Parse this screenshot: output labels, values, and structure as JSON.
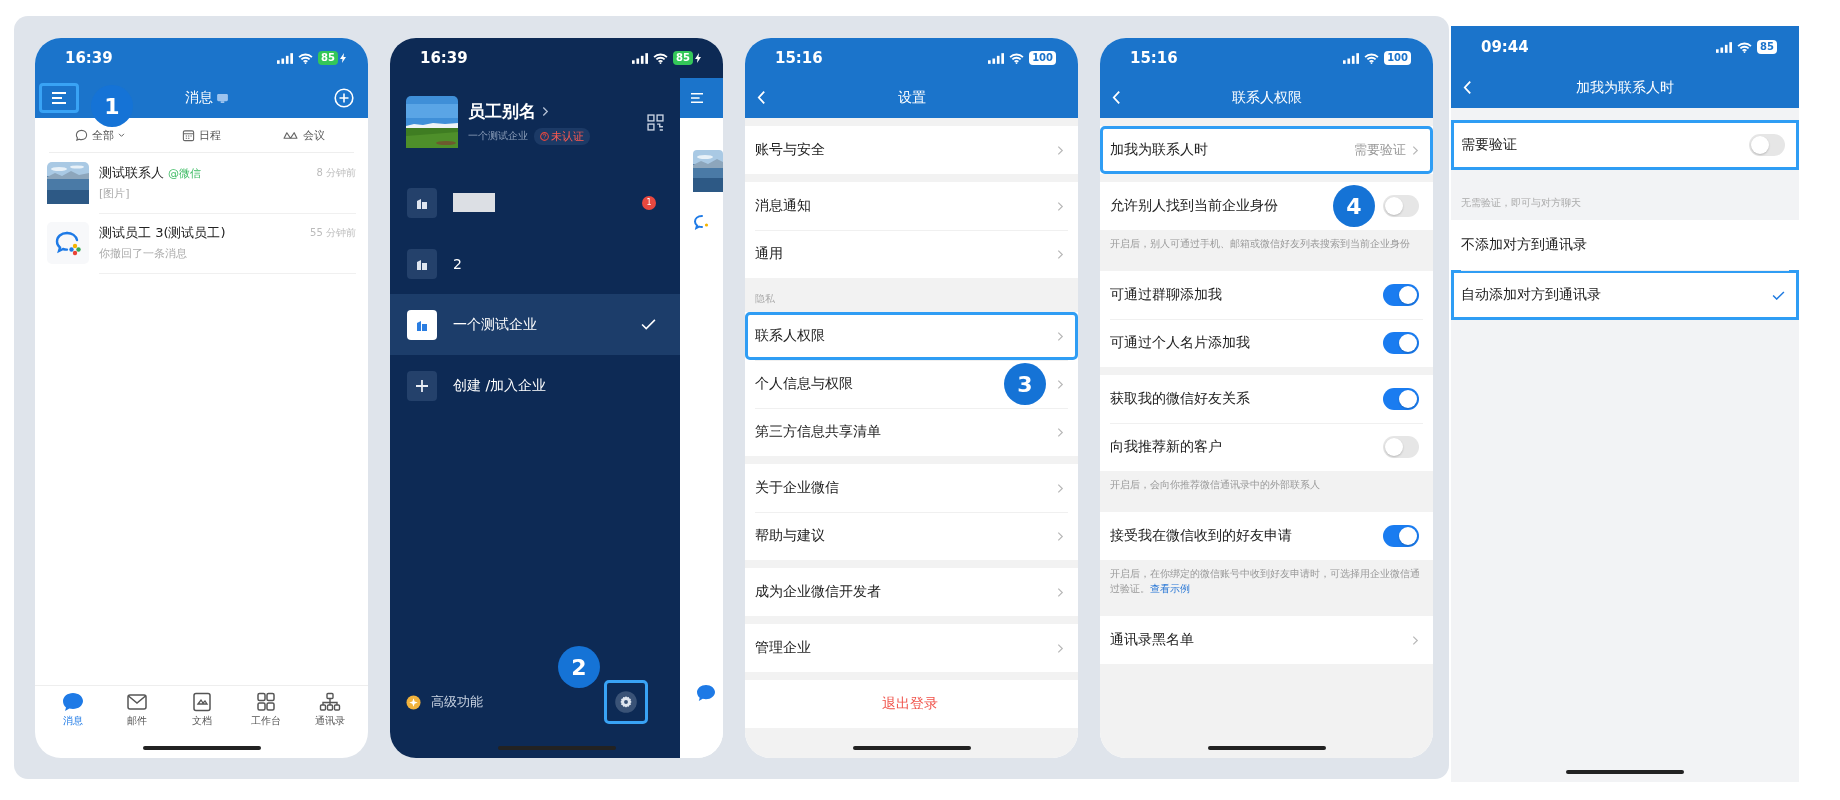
{
  "panel_screens": [
    {
      "kind": "messages",
      "status": {
        "time": "16:39",
        "battery": "85",
        "charging": true
      },
      "header": {
        "title": "消息",
        "menu_highlighted": true,
        "step": "1"
      },
      "filters": [
        {
          "label": "全部",
          "kind": "all"
        },
        {
          "label": "日程",
          "kind": "calendar"
        },
        {
          "label": "会议",
          "kind": "meeting"
        }
      ],
      "chats": [
        {
          "kind": "picture",
          "name": "测试联系人",
          "tag": "@微信",
          "preview": "[图片]",
          "time": "8 分钟前"
        },
        {
          "kind": "logo",
          "name": "测试员工 3(测试员工)",
          "preview": "你撤回了一条消息",
          "time": "55 分钟前"
        }
      ],
      "tabs": [
        {
          "label": "消息",
          "selected": true
        },
        {
          "label": "邮件",
          "selected": false
        },
        {
          "label": "文档",
          "selected": false
        },
        {
          "label": "工作台",
          "selected": false
        },
        {
          "label": "通讯录",
          "selected": false
        }
      ]
    },
    {
      "kind": "drawer",
      "status": {
        "time": "16:39",
        "battery": "85",
        "charging": true
      },
      "profile": {
        "name": "员工别名",
        "company": "一个测试企业",
        "badge": "未认证"
      },
      "companies": [
        {
          "redacted": true,
          "badge": "1",
          "selected": false
        },
        {
          "name": "2",
          "selected": false
        },
        {
          "name": "一个测试企业",
          "selected": true
        }
      ],
      "create": "创建 /加入企业",
      "footer": {
        "label": "高级功能",
        "settings_highlighted": true,
        "step": "2"
      }
    },
    {
      "kind": "settings",
      "status": {
        "time": "15:16",
        "battery": "100",
        "charging": false
      },
      "title": "设置",
      "groups": [
        {
          "items": [
            {
              "kind": "link",
              "label": "账号与安全",
              "highlighted": false
            }
          ]
        },
        {
          "items": [
            {
              "kind": "link",
              "label": "消息通知",
              "highlighted": false
            },
            {
              "kind": "link",
              "label": "通用",
              "highlighted": false
            }
          ]
        },
        {
          "header": "隐私",
          "items": [
            {
              "kind": "link",
              "label": "联系人权限",
              "highlighted": true
            },
            {
              "kind": "link",
              "label": "个人信息与权限",
              "highlighted": false,
              "step": "3"
            },
            {
              "kind": "link",
              "label": "第三方信息共享清单",
              "highlighted": false
            }
          ]
        },
        {
          "items": [
            {
              "kind": "link",
              "label": "关于企业微信",
              "highlighted": false
            },
            {
              "kind": "link",
              "label": "帮助与建议",
              "highlighted": false
            }
          ]
        },
        {
          "items": [
            {
              "kind": "link",
              "label": "成为企业微信开发者",
              "highlighted": false
            }
          ]
        },
        {
          "items": [
            {
              "kind": "link",
              "label": "管理企业",
              "highlighted": false
            }
          ]
        },
        {
          "items": [
            {
              "kind": "action",
              "label": "退出登录",
              "highlighted": false
            }
          ]
        }
      ]
    },
    {
      "kind": "settings",
      "status": {
        "time": "15:16",
        "battery": "100",
        "charging": false
      },
      "title": "联系人权限",
      "groups": [
        {
          "items": [
            {
              "kind": "link",
              "label": "加我为联系人时",
              "value": "需要验证",
              "highlighted": true
            }
          ]
        },
        {
          "items": [
            {
              "kind": "toggle",
              "label": "允许别人找到当前企业身份",
              "on": false,
              "highlighted": false,
              "step": "4"
            }
          ],
          "note": "开启后，别人可通过手机、邮箱或微信好友列表搜索到当前企业身份"
        },
        {
          "items": [
            {
              "kind": "toggle",
              "label": "可通过群聊添加我",
              "on": true,
              "highlighted": false
            },
            {
              "kind": "toggle",
              "label": "可通过个人名片添加我",
              "on": true,
              "highlighted": false
            }
          ]
        },
        {
          "items": [
            {
              "kind": "toggle",
              "label": "获取我的微信好友关系",
              "on": true,
              "highlighted": false
            },
            {
              "kind": "toggle",
              "label": "向我推荐新的客户",
              "on": false,
              "highlighted": false
            }
          ],
          "note": "开启后，会向你推荐微信通讯录中的外部联系人"
        },
        {
          "items": [
            {
              "kind": "toggle",
              "label": "接受我在微信收到的好友申请",
              "on": true,
              "highlighted": false
            }
          ],
          "note": "开启后，在你绑定的微信账号中收到好友申请时，可选择用企业微信通过验证。",
          "note_link": "查看示例"
        },
        {
          "items": [
            {
              "kind": "link",
              "label": "通讯录黑名单",
              "highlighted": false
            }
          ]
        }
      ]
    }
  ],
  "extra_screen": {
    "kind": "settings",
    "status": {
      "time": "09:44",
      "battery": "85",
      "charging": false
    },
    "title": "加我为联系人时",
    "groups": [
      {
        "items": [
          {
            "kind": "toggle",
            "label": "需要验证",
            "on": false,
            "highlighted": true
          }
        ]
      },
      {
        "header": "无需验证，即可与对方聊天",
        "items": [
          {
            "kind": "option",
            "label": "不添加对方到通讯录",
            "selected": false,
            "highlighted": false
          },
          {
            "kind": "option",
            "label": "自动添加对方到通讯录",
            "selected": true,
            "highlighted": true
          }
        ]
      }
    ]
  }
}
